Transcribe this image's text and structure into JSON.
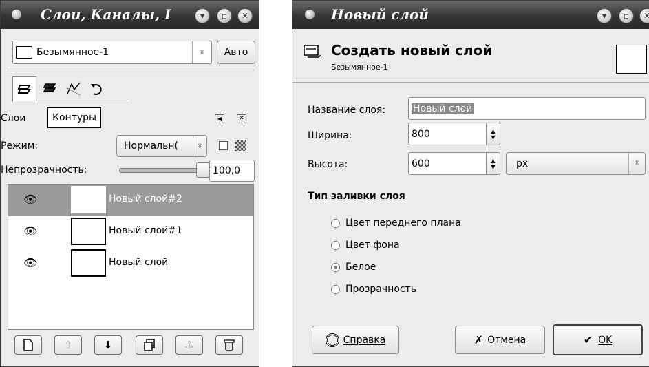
{
  "layers_window": {
    "title": "Слои, Каналы, I",
    "image_name": "Безымянное-1",
    "auto_button": "Авто",
    "tab_tooltip": "Контуры",
    "tab_label": "Слои",
    "mode_label": "Режим:",
    "mode_value": "Нормальн(",
    "opacity_label": "Непрозрачность:",
    "opacity_value": "100,0",
    "opacity_fraction": 1.0,
    "layers": [
      {
        "name": "Новый слой#2",
        "selected": true
      },
      {
        "name": "Новый слой#1",
        "selected": false
      },
      {
        "name": "Новый слой",
        "selected": false
      }
    ]
  },
  "new_layer_window": {
    "title": "Новый слой",
    "heading": "Создать новый слой",
    "subheading": "Безымянное-1",
    "name_label": "Название слоя:",
    "name_value": "Новый слой",
    "width_label": "Ширина:",
    "width_value": "800",
    "height_label": "Высота:",
    "height_value": "600",
    "unit_value": "px",
    "fill_heading": "Тип заливки слоя",
    "fill_options": [
      "Цвет переднего плана",
      "Цвет фона",
      "Белое",
      "Прозрачность"
    ],
    "fill_selected": "Белое",
    "help_button": "Справка",
    "cancel_button": "Отмена",
    "ok_button": "OK"
  },
  "colors": {
    "selected_row": "#9a9a9a",
    "titlebar": "#343434"
  }
}
